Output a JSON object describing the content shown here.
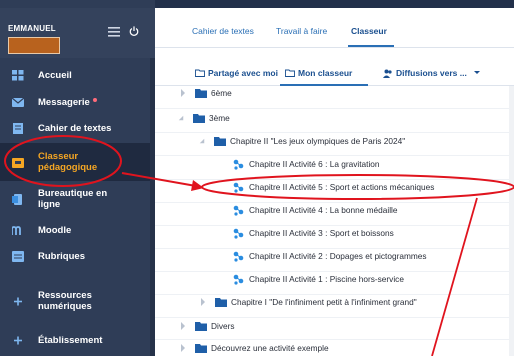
{
  "colors": {
    "sidebar": "#2f3d57",
    "accent_orange": "#f5a623",
    "link_blue": "#2a6fb5",
    "folder_blue": "#1f5fa8",
    "annotation_red": "#e0141e"
  },
  "user": {
    "name": "EMMANUEL"
  },
  "sidebar": {
    "items": [
      {
        "label": "Accueil",
        "icon": "home-grid-icon"
      },
      {
        "label": "Messagerie",
        "icon": "envelope-icon",
        "has_notification": true
      },
      {
        "label": "Cahier de textes",
        "icon": "notebook-icon"
      },
      {
        "label": "Classeur pédagogique",
        "icon": "folder-binder-icon",
        "active": true
      },
      {
        "label": "Bureautique en ligne",
        "icon": "office-icon"
      },
      {
        "label": "Moodle",
        "icon": "moodle-icon"
      },
      {
        "label": "Rubriques",
        "icon": "rubrics-icon"
      },
      {
        "label": "Ressources numériques",
        "icon": "plus-icon"
      },
      {
        "label": "Établissement",
        "icon": "plus-icon"
      }
    ]
  },
  "tabs": {
    "t1": "Cahier de textes",
    "t2": "Travail à faire",
    "t3": "Classeur"
  },
  "subtabs": {
    "shared": "Partagé avec moi",
    "mine": "Mon classeur",
    "diffusions": "Diffusions vers ..."
  },
  "tree": {
    "r1": "6ème",
    "r2": "3ème",
    "r3": "Chapitre II \"Les jeux olympiques de Paris 2024\"",
    "r4": "Chapitre II Activité 6 : La gravitation",
    "r5": "Chapitre II Activité 5 : Sport et actions mécaniques",
    "r6": "Chapitre II Activité 4 : La bonne médaille",
    "r7": "Chapitre II Activité 3 : Sport et boissons",
    "r8": "Chapitre II Activité 2 : Dopages et pictogrammes",
    "r9": "Chapitre II Activité 1 : Piscine hors-service",
    "r10": "Chapitre I \"De l'infiniment petit à l'infiniment grand\"",
    "r11": "Divers",
    "r12": "Découvrez une activité exemple"
  }
}
